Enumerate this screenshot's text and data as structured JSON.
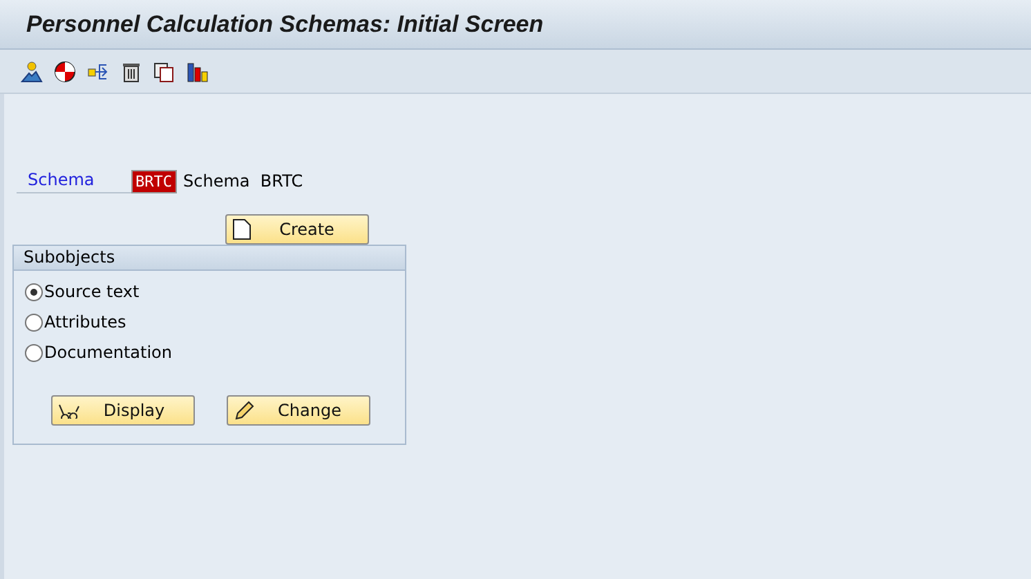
{
  "window": {
    "title": "Personnel Calculation Schemas: Initial Screen"
  },
  "toolbar": {
    "icons": [
      {
        "kind": "person"
      },
      {
        "kind": "lifebuoy"
      },
      {
        "kind": "route"
      },
      {
        "kind": "trash"
      },
      {
        "kind": "copy"
      },
      {
        "kind": "chart"
      }
    ]
  },
  "schema": {
    "label": "Schema",
    "value": "BRTC",
    "description": "Schema  BRTC"
  },
  "create_button": {
    "label": "Create"
  },
  "subobjects": {
    "title": "Subobjects",
    "options": [
      {
        "label": "Source text",
        "selected": true
      },
      {
        "label": "Attributes",
        "selected": false
      },
      {
        "label": "Documentation",
        "selected": false
      }
    ],
    "buttons": [
      {
        "kind": "display",
        "label": "Display"
      },
      {
        "kind": "change",
        "label": "Change"
      }
    ]
  }
}
